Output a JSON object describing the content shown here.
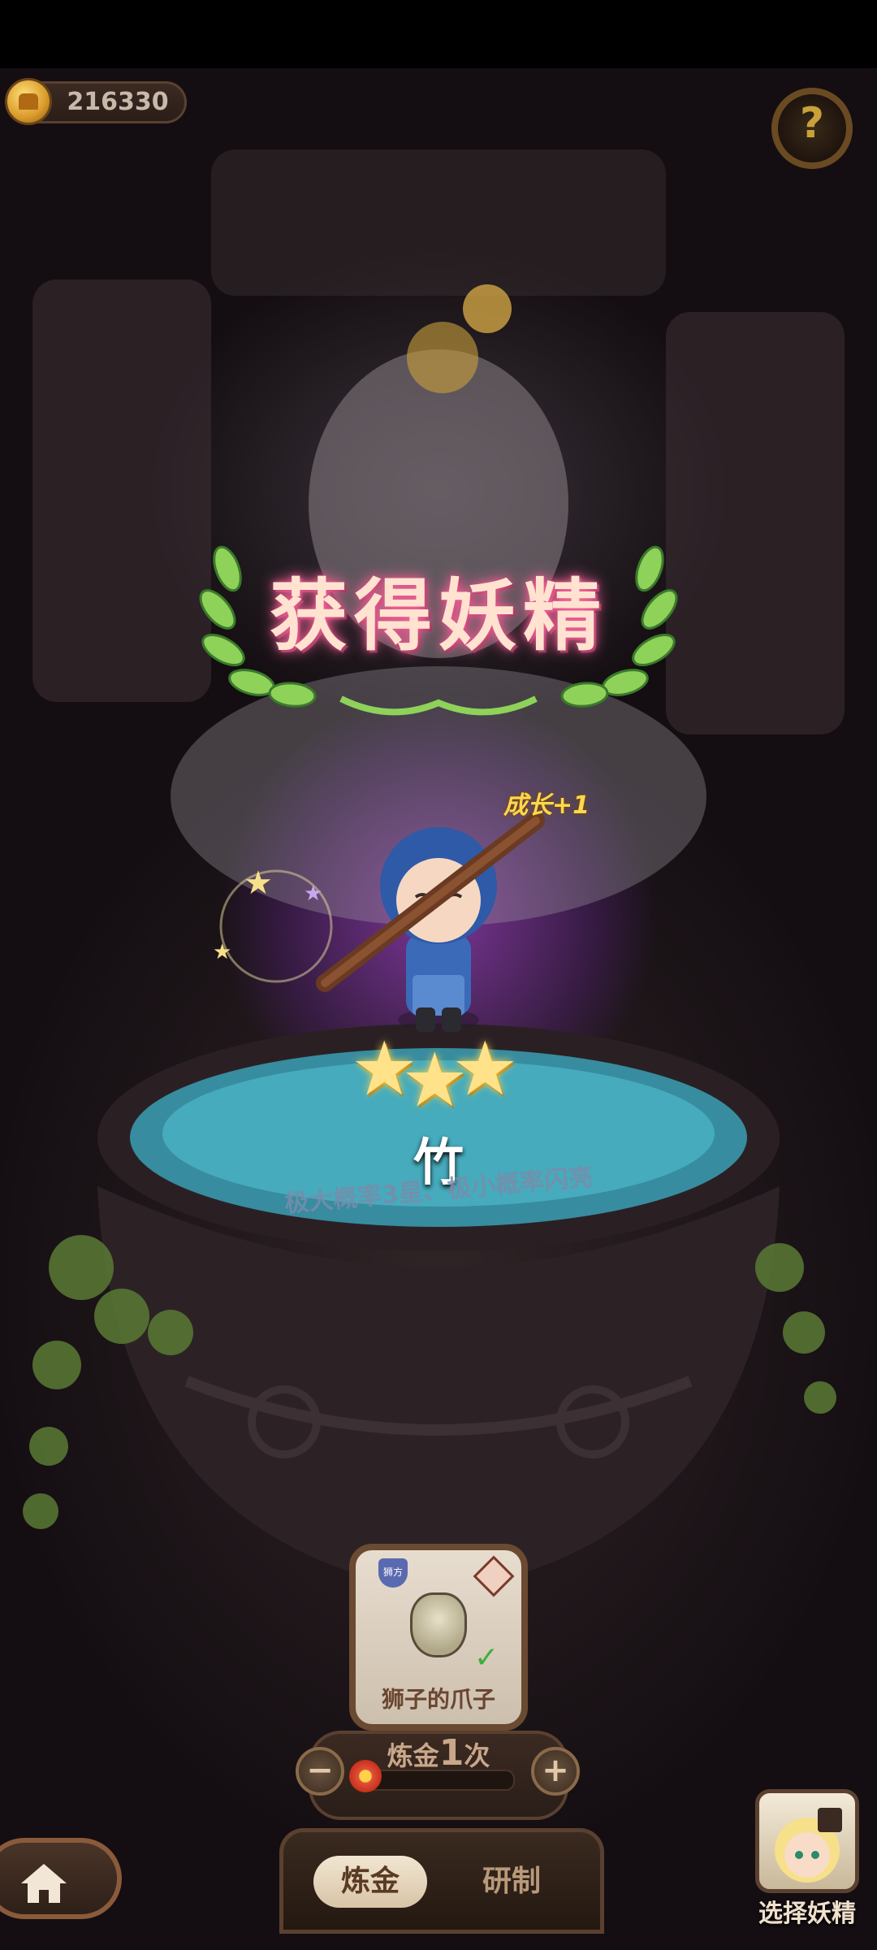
{
  "hud": {
    "coins": "216330",
    "help_symbol": "?"
  },
  "reward": {
    "title": "获得妖精",
    "growth": "成长+1",
    "stars": 3,
    "fairy_name": "竹",
    "probability_text": "极大概率3星、极小概率闪亮"
  },
  "alchemy": {
    "card_label": "狮子的爪子",
    "card_tag": "狮方",
    "count_prefix": "炼金",
    "count_value": "1",
    "count_suffix": "次",
    "minus_symbol": "−",
    "plus_symbol": "+",
    "progress_fraction": 0.05
  },
  "tabs": [
    {
      "label": "炼金",
      "active": true
    },
    {
      "label": "研制",
      "active": false
    }
  ],
  "select_fairy": {
    "label": "选择妖精"
  },
  "colors": {
    "background": "#1a1216",
    "glow": "#c850ff",
    "title_glow": "#ff6aa0",
    "gold": "#ffd84a"
  }
}
